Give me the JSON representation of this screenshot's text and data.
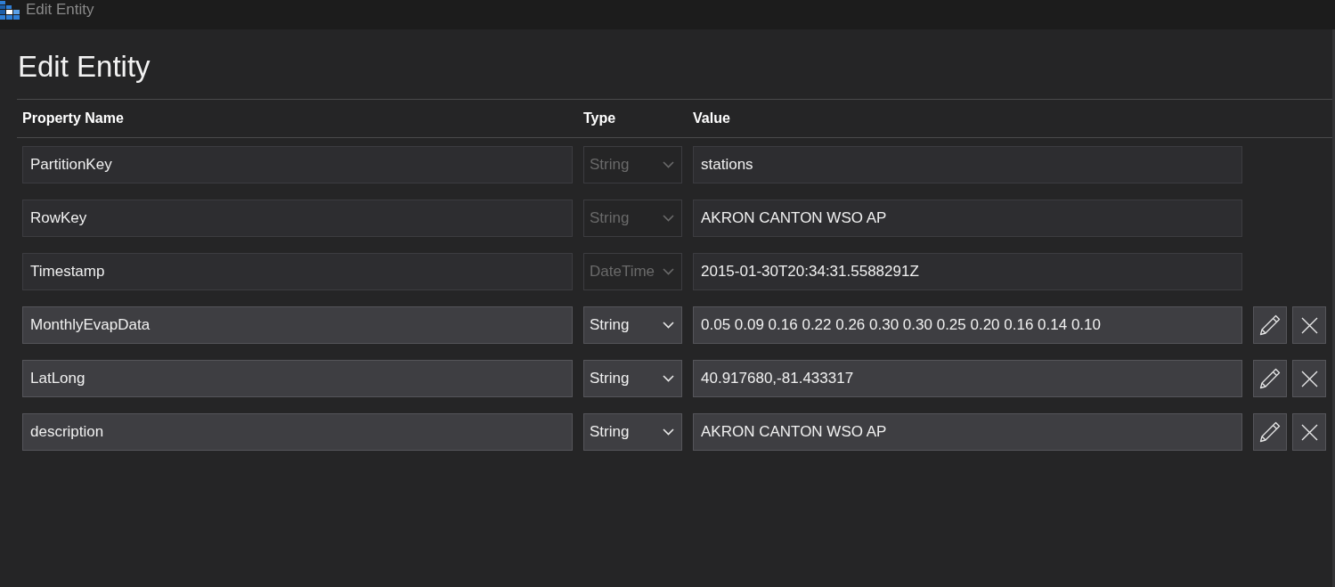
{
  "window": {
    "title": "Edit Entity"
  },
  "heading": "Edit Entity",
  "table": {
    "columns": [
      "Property Name",
      "Type",
      "Value"
    ],
    "rows": [
      {
        "name": "PartitionKey",
        "type": "String",
        "value": "stations",
        "disabled": true
      },
      {
        "name": "RowKey",
        "type": "String",
        "value": "AKRON CANTON WSO AP",
        "disabled": true
      },
      {
        "name": "Timestamp",
        "type": "DateTime",
        "value": "2015-01-30T20:34:31.5588291Z",
        "disabled": true
      },
      {
        "name": "MonthlyEvapData",
        "type": "String",
        "value": "0.05 0.09 0.16 0.22 0.26 0.30 0.30 0.25 0.20 0.16 0.14 0.10",
        "disabled": false
      },
      {
        "name": "LatLong",
        "type": "String",
        "value": "40.917680,-81.433317",
        "disabled": false
      },
      {
        "name": "description",
        "type": "String",
        "value": "AKRON CANTON WSO AP",
        "disabled": false
      }
    ]
  }
}
